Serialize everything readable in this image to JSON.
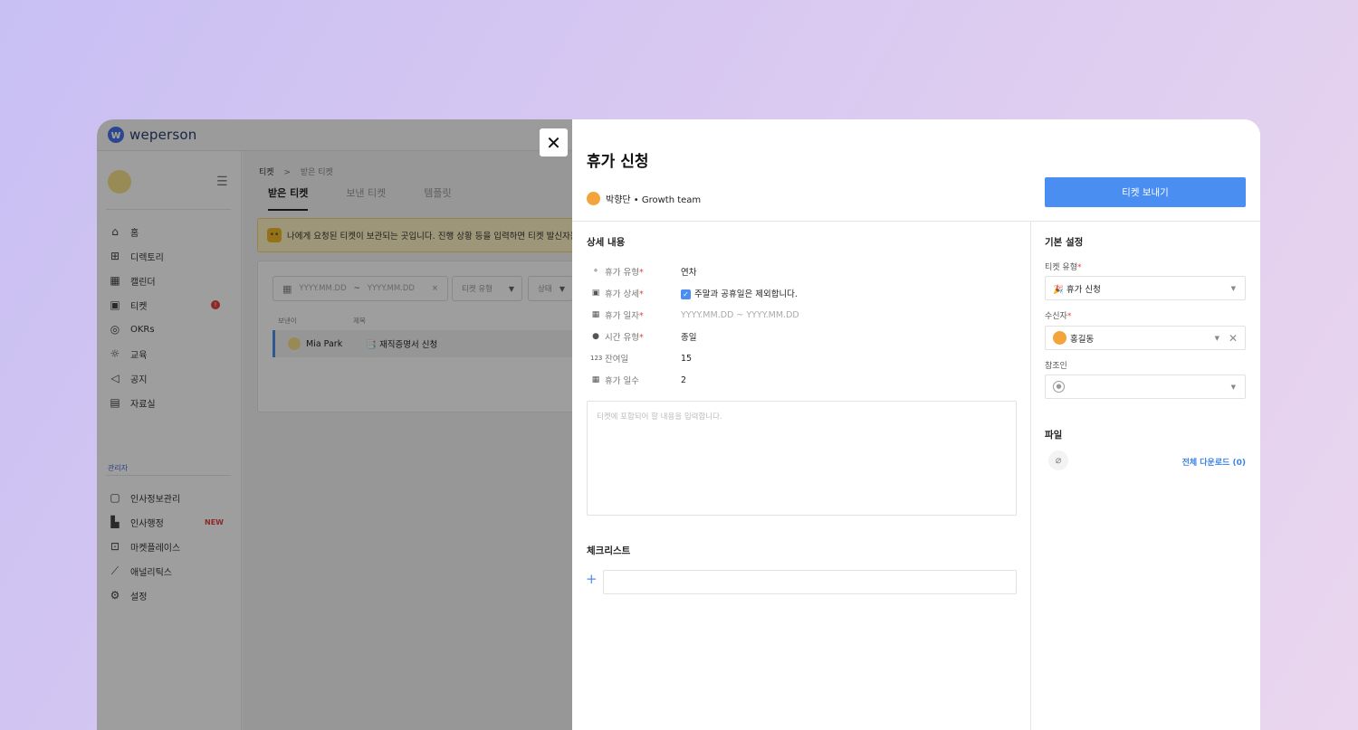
{
  "app": {
    "logo_mark": "w",
    "logo_text": "weperson"
  },
  "sidebar": {
    "menu_icon": "menu-icon",
    "items": [
      {
        "label": "홈",
        "icon": "home-icon"
      },
      {
        "label": "디렉토리",
        "icon": "directory-icon"
      },
      {
        "label": "캘린더",
        "icon": "calendar-icon"
      },
      {
        "label": "티켓",
        "icon": "ticket-icon",
        "badge": "!"
      },
      {
        "label": "OKRs",
        "icon": "target-icon"
      },
      {
        "label": "교육",
        "icon": "bulb-icon"
      },
      {
        "label": "공지",
        "icon": "megaphone-icon"
      },
      {
        "label": "자료실",
        "icon": "archive-icon"
      }
    ],
    "admin_label": "관리자",
    "admin_items": [
      {
        "label": "인사정보관리",
        "icon": "hr-info-icon"
      },
      {
        "label": "인사행정",
        "icon": "hr-admin-icon",
        "new_badge": "NEW"
      },
      {
        "label": "마켓플레이스",
        "icon": "gift-icon"
      },
      {
        "label": "애널리틱스",
        "icon": "chart-icon"
      },
      {
        "label": "설정",
        "icon": "gear-icon"
      }
    ]
  },
  "main": {
    "breadcrumb": {
      "root": "티켓",
      "sep": ">",
      "current": "받은 티켓"
    },
    "tabs": [
      {
        "label": "받은 티켓",
        "active": true
      },
      {
        "label": "보낸 티켓",
        "active": false
      },
      {
        "label": "템플릿",
        "active": false
      }
    ],
    "notice": "나에게 요청된 티켓이 보관되는 곳입니다. 진행 상황 등을 입력하면 티켓 발신자는 보낸",
    "filter": {
      "date_start": "YYYY.MM.DD",
      "date_sep": "~",
      "date_end": "YYYY.MM.DD",
      "clear": "×",
      "type_label": "티켓 유형",
      "status_label": "상태"
    },
    "list_headers": {
      "sender": "보낸이",
      "title": "제목"
    },
    "rows": [
      {
        "sender": "Mia Park",
        "title": "📑 재직증명서 신청"
      }
    ]
  },
  "drawer": {
    "close": "✕",
    "title": "휴가 신청",
    "author": "박향단 • Growth team",
    "send_button": "티켓 보내기",
    "details_title": "상세 내용",
    "fields": [
      {
        "icon": "type-icon",
        "label": "휴가 유형",
        "required": "*",
        "value": "연차"
      },
      {
        "icon": "calendar-check-icon",
        "label": "휴가 상세",
        "required": "*",
        "value": "주말과 공휴일은 제외합니다.",
        "checked": true
      },
      {
        "icon": "calendar-icon",
        "label": "휴가 일자",
        "required": "*",
        "value": "YYYY.MM.DD ~ YYYY.MM.DD",
        "placeholder": true
      },
      {
        "icon": "clock-icon",
        "label": "시간 유형",
        "required": "*",
        "value": "종일"
      },
      {
        "icon": "number-icon",
        "label": "잔여일",
        "required": "",
        "value": "15"
      },
      {
        "icon": "calendar-days-icon",
        "label": "휴가 일수",
        "required": "",
        "value": "2"
      }
    ],
    "content_placeholder": "티켓에 포함되어 할 내용을 입력합니다.",
    "checklist_title": "체크리스트",
    "checklist_add": "+",
    "settings_title": "기본 설정",
    "ticket_type_label": "티켓 유형",
    "ticket_type_value": "🎉 휴가 신청",
    "recipient_label": "수신자",
    "recipient_value": "홍길동",
    "cc_label": "참조인",
    "files_title": "파일",
    "download_all": "전체 다운로드 (0)",
    "accent": "#4a8ef2"
  }
}
